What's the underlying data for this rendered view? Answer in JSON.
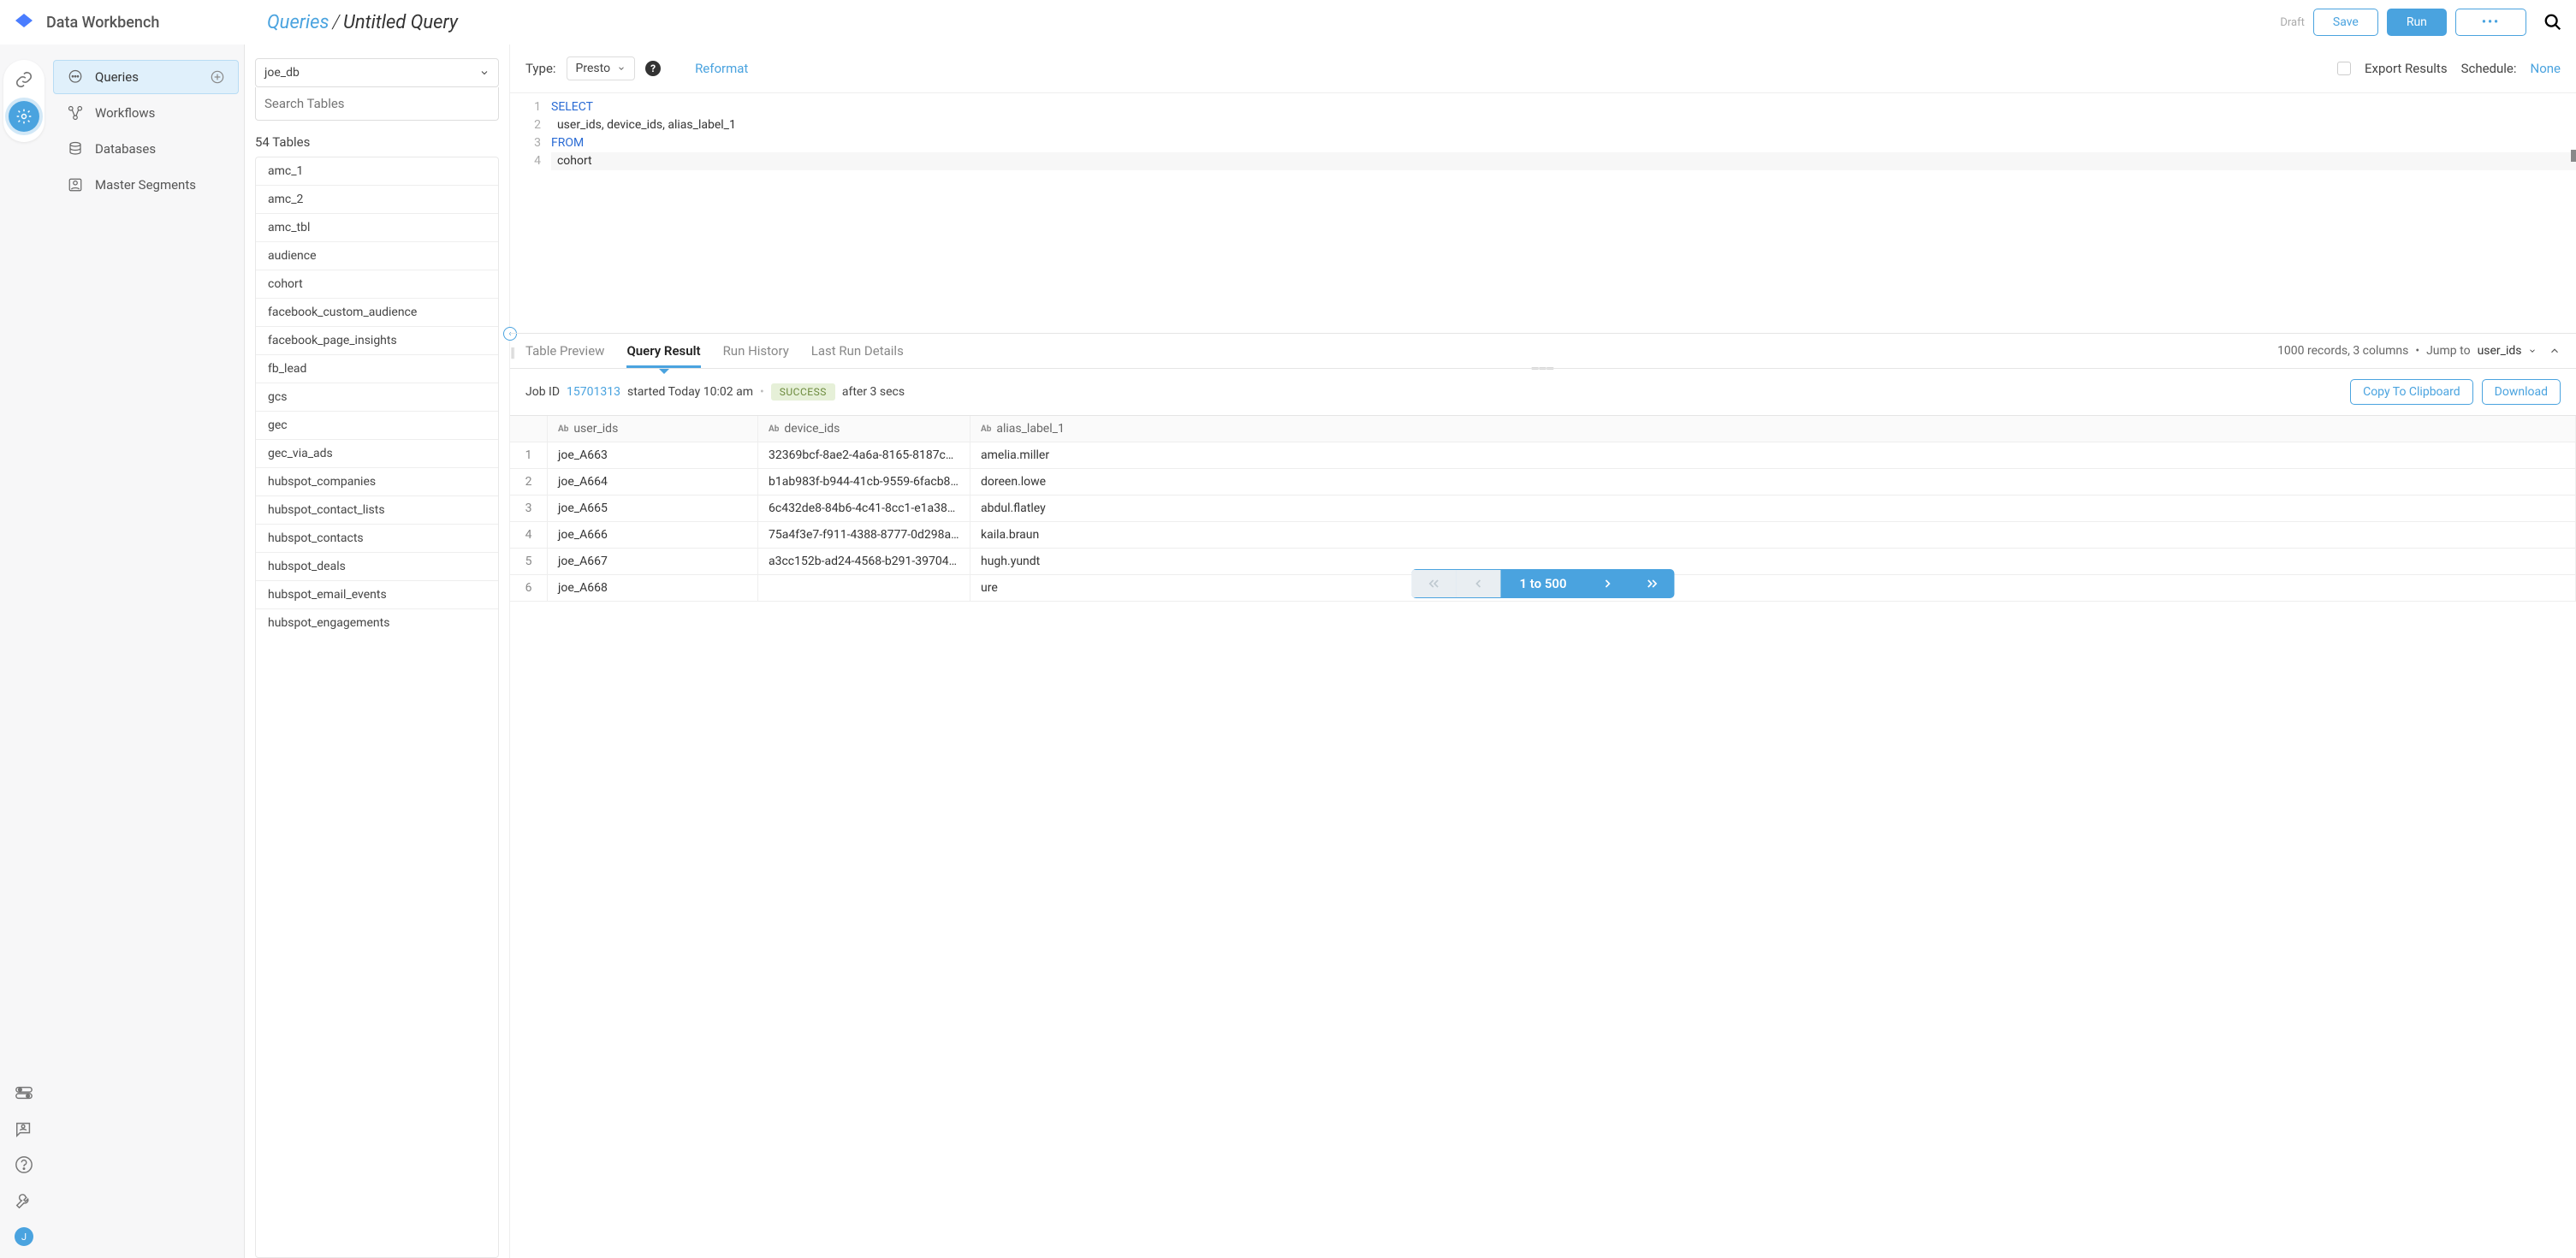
{
  "header": {
    "app_title": "Data Workbench",
    "breadcrumb_root": "Queries",
    "breadcrumb_sep": "/",
    "breadcrumb_current": "Untitled Query",
    "draft": "Draft",
    "save": "Save",
    "run": "Run",
    "more": "•••"
  },
  "sidebar": {
    "items": [
      {
        "label": "Queries",
        "icon": "chat-bubble"
      },
      {
        "label": "Workflows",
        "icon": "flow"
      },
      {
        "label": "Databases",
        "icon": "database"
      },
      {
        "label": "Master Segments",
        "icon": "segments"
      }
    ]
  },
  "tables_panel": {
    "db_selected": "joe_db",
    "search_placeholder": "Search Tables",
    "count_label": "54 Tables",
    "tables": [
      "amc_1",
      "amc_2",
      "amc_tbl",
      "audience",
      "cohort",
      "facebook_custom_audience",
      "facebook_page_insights",
      "fb_lead",
      "gcs",
      "gec",
      "gec_via_ads",
      "hubspot_companies",
      "hubspot_contact_lists",
      "hubspot_contacts",
      "hubspot_deals",
      "hubspot_email_events",
      "hubspot_engagements"
    ]
  },
  "editor": {
    "type_label": "Type:",
    "type_value": "Presto",
    "reformat": "Reformat",
    "export_label": "Export Results",
    "schedule_label": "Schedule:",
    "schedule_value": "None",
    "code_lines_count": 4,
    "code": {
      "l1_kw": "SELECT",
      "l2": "  user_ids, device_ids, alias_label_1",
      "l3_kw": "FROM",
      "l4": "  cohort"
    }
  },
  "results": {
    "tabs": [
      "Table Preview",
      "Query Result",
      "Run History",
      "Last Run Details"
    ],
    "active_tab_index": 1,
    "summary_records": "1000 records, 3 columns",
    "jump_label": "Jump to",
    "jump_value": "user_ids",
    "job_label": "Job ID",
    "job_id": "15701313",
    "job_started": "started Today 10:02 am",
    "job_status": "SUCCESS",
    "job_duration": "after 3 secs",
    "copy_btn": "Copy To Clipboard",
    "download_btn": "Download",
    "columns": [
      {
        "type": "Ab",
        "name": "user_ids"
      },
      {
        "type": "Ab",
        "name": "device_ids"
      },
      {
        "type": "Ab",
        "name": "alias_label_1"
      }
    ],
    "rows": [
      {
        "n": "1",
        "user_ids": "joe_A663",
        "device_ids": "32369bcf-8ae2-4a6a-8165-8187c5…",
        "alias": "amelia.miller"
      },
      {
        "n": "2",
        "user_ids": "joe_A664",
        "device_ids": "b1ab983f-b944-41cb-9559-6facb84…",
        "alias": "doreen.lowe"
      },
      {
        "n": "3",
        "user_ids": "joe_A665",
        "device_ids": "6c432de8-84b6-4c41-8cc1-e1a38a…",
        "alias": "abdul.flatley"
      },
      {
        "n": "4",
        "user_ids": "joe_A666",
        "device_ids": "75a4f3e7-f911-4388-8777-0d298a…",
        "alias": "kaila.braun"
      },
      {
        "n": "5",
        "user_ids": "joe_A667",
        "device_ids": "a3cc152b-ad24-4568-b291-39704c…",
        "alias": "hugh.yundt"
      },
      {
        "n": "6",
        "user_ids": "joe_A668",
        "device_ids": "",
        "alias": "ure"
      }
    ],
    "pager_label": "1 to 500"
  },
  "avatar_initial": "J"
}
